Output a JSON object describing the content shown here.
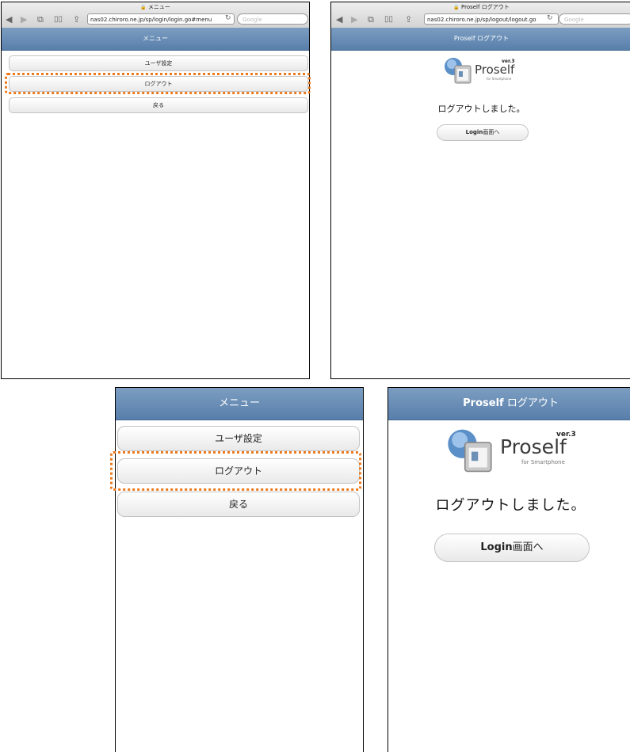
{
  "menu_screen": {
    "page_title": "メニュー",
    "url": "nas02.chiroro.ne.jp/sp/login/login.go#menu",
    "search_placeholder": "Google",
    "header_title": "メニュー",
    "buttons": {
      "user_settings": "ユーザ設定",
      "logout": "ログアウト",
      "back": "戻る"
    }
  },
  "logout_screen": {
    "page_title": "Proself ログアウト",
    "url": "nas02.chiroro.ne.jp/sp/logout/logout.go",
    "search_placeholder": "Google",
    "header_title": "Proself ログアウト",
    "header_brand": "Proself",
    "header_rest": " ログアウト",
    "logo": {
      "brand": "Proself",
      "version": "ver.3",
      "tagline": "for Smartphone"
    },
    "message": "ログアウトしました。",
    "login_button": {
      "strong": "Login",
      "rest": "画面へ"
    }
  },
  "icons": {
    "lock": "🔒",
    "back": "◀",
    "forward": "▶",
    "tabs": "⧉",
    "bookmarks": "📖",
    "share": "⇪",
    "reload": "↻"
  },
  "colors": {
    "header_blue": "#6a8fb8",
    "highlight_orange": "#ec7a1c"
  }
}
